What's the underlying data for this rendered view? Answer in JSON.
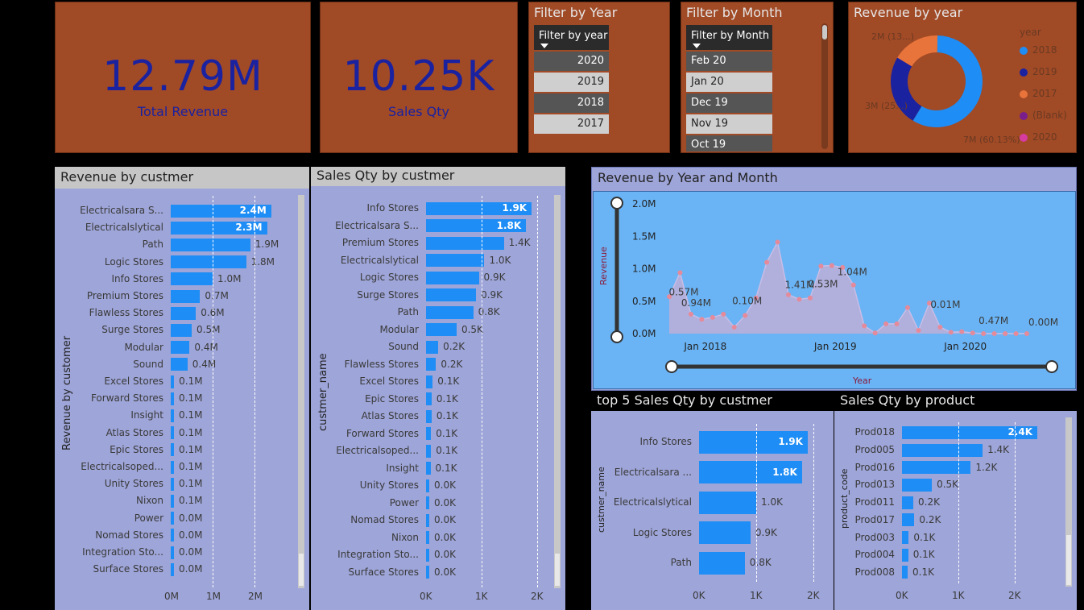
{
  "kpis": {
    "revenue": {
      "value": "12.79M",
      "label": "Total Revenue"
    },
    "qty": {
      "value": "10.25K",
      "label": "Sales Qty"
    }
  },
  "colors": {
    "accent": "#1e8df5",
    "kpi_bg": "#a14a26",
    "kpi_text": "#1b22a0",
    "panel_bg": "#9ea5d8",
    "line_panel_bg": "#6ab4f5"
  },
  "year_slicer": {
    "title": "Filter by Year",
    "header": "Filter by year",
    "items": [
      "2020",
      "2019",
      "2018",
      "2017"
    ]
  },
  "month_slicer": {
    "title": "Filter by Month",
    "header": "Filter by Month",
    "items": [
      "Feb 20",
      "Jan 20",
      "Dec 19",
      "Nov 19",
      "Oct 19"
    ]
  },
  "donut": {
    "title": "Revenue by year",
    "legend_title": "year",
    "legend": [
      {
        "name": "2018",
        "color": "#1e8df5"
      },
      {
        "name": "2019",
        "color": "#1b22a0"
      },
      {
        "name": "2017",
        "color": "#e8743b"
      },
      {
        "name": "(Blank)",
        "color": "#7a1e8c"
      },
      {
        "name": "2020",
        "color": "#d63ba0"
      }
    ],
    "labels": {
      "top": "2M (13...)",
      "left": "3M (25...)",
      "right": "7M (60.13%)"
    }
  },
  "rev_by_cust": {
    "title": "Revenue by custmer",
    "y_title": "Revenue by customer",
    "ticks": [
      "0M",
      "1M",
      "2M"
    ],
    "rows": [
      {
        "name": "Electricalsara S...",
        "value": 2.4,
        "label": "2.4M"
      },
      {
        "name": "Electricalslytical",
        "value": 2.3,
        "label": "2.3M"
      },
      {
        "name": "Path",
        "value": 1.9,
        "label": "1.9M"
      },
      {
        "name": "Logic Stores",
        "value": 1.8,
        "label": "1.8M"
      },
      {
        "name": "Info Stores",
        "value": 1.0,
        "label": "1.0M"
      },
      {
        "name": "Premium Stores",
        "value": 0.7,
        "label": "0.7M"
      },
      {
        "name": "Flawless Stores",
        "value": 0.6,
        "label": "0.6M"
      },
      {
        "name": "Surge Stores",
        "value": 0.5,
        "label": "0.5M"
      },
      {
        "name": "Modular",
        "value": 0.45,
        "label": "0.4M"
      },
      {
        "name": "Sound",
        "value": 0.4,
        "label": "0.4M"
      },
      {
        "name": "Excel Stores",
        "value": 0.08,
        "label": "0.1M"
      },
      {
        "name": "Forward Stores",
        "value": 0.07,
        "label": "0.1M"
      },
      {
        "name": "Insight",
        "value": 0.06,
        "label": "0.1M"
      },
      {
        "name": "Atlas Stores",
        "value": 0.06,
        "label": "0.1M"
      },
      {
        "name": "Epic Stores",
        "value": 0.05,
        "label": "0.1M"
      },
      {
        "name": "Electricalsoped...",
        "value": 0.05,
        "label": "0.1M"
      },
      {
        "name": "Unity Stores",
        "value": 0.05,
        "label": "0.1M"
      },
      {
        "name": "Nixon",
        "value": 0.05,
        "label": "0.1M"
      },
      {
        "name": "Power",
        "value": 0.04,
        "label": "0.0M"
      },
      {
        "name": "Nomad Stores",
        "value": 0.04,
        "label": "0.0M"
      },
      {
        "name": "Integration Sto...",
        "value": 0.03,
        "label": "0.0M"
      },
      {
        "name": "Surface Stores",
        "value": 0.03,
        "label": "0.0M"
      }
    ]
  },
  "qty_by_cust": {
    "title": "Sales Qty by custmer",
    "y_title": "custmer_name",
    "ticks": [
      "0K",
      "1K",
      "2K"
    ],
    "rows": [
      {
        "name": "Info Stores",
        "value": 1.9,
        "label": "1.9K"
      },
      {
        "name": "Electricalsara S...",
        "value": 1.8,
        "label": "1.8K"
      },
      {
        "name": "Premium Stores",
        "value": 1.4,
        "label": "1.4K"
      },
      {
        "name": "Electricalslytical",
        "value": 1.05,
        "label": "1.0K"
      },
      {
        "name": "Logic Stores",
        "value": 0.95,
        "label": "0.9K"
      },
      {
        "name": "Surge Stores",
        "value": 0.9,
        "label": "0.9K"
      },
      {
        "name": "Path",
        "value": 0.85,
        "label": "0.8K"
      },
      {
        "name": "Modular",
        "value": 0.55,
        "label": "0.5K"
      },
      {
        "name": "Sound",
        "value": 0.22,
        "label": "0.2K"
      },
      {
        "name": "Flawless Stores",
        "value": 0.18,
        "label": "0.2K"
      },
      {
        "name": "Excel Stores",
        "value": 0.12,
        "label": "0.1K"
      },
      {
        "name": "Epic Stores",
        "value": 0.1,
        "label": "0.1K"
      },
      {
        "name": "Atlas Stores",
        "value": 0.1,
        "label": "0.1K"
      },
      {
        "name": "Forward Stores",
        "value": 0.09,
        "label": "0.1K"
      },
      {
        "name": "Electricalsoped...",
        "value": 0.09,
        "label": "0.1K"
      },
      {
        "name": "Insight",
        "value": 0.08,
        "label": "0.1K"
      },
      {
        "name": "Unity Stores",
        "value": 0.04,
        "label": "0.0K"
      },
      {
        "name": "Power",
        "value": 0.04,
        "label": "0.0K"
      },
      {
        "name": "Nomad Stores",
        "value": 0.03,
        "label": "0.0K"
      },
      {
        "name": "Nixon",
        "value": 0.03,
        "label": "0.0K"
      },
      {
        "name": "Integration Sto...",
        "value": 0.02,
        "label": "0.0K"
      },
      {
        "name": "Surface Stores",
        "value": 0.02,
        "label": "0.0K"
      }
    ]
  },
  "line": {
    "title": "Revenue by Year and Month",
    "y_title": "Revenue",
    "x_title": "Year",
    "y_ticks": [
      "2.0M",
      "1.5M",
      "1.0M",
      "0.5M",
      "0.0M"
    ],
    "x_ticks": [
      "Jan 2018",
      "Jan 2019",
      "Jan 2020"
    ],
    "annotations": [
      {
        "text": "0.94M",
        "i": 2
      },
      {
        "text": "0.57M",
        "i": 1
      },
      {
        "text": "0.10M",
        "i": 7
      },
      {
        "text": "1.41M",
        "i": 12
      },
      {
        "text": "0.53M",
        "i": 14
      },
      {
        "text": "1.04M",
        "i": 17
      },
      {
        "text": "0.01M",
        "i": 25
      },
      {
        "text": "0.47M",
        "i": 29
      },
      {
        "text": "0.00M",
        "i": 33
      }
    ]
  },
  "chart_data": [
    {
      "type": "area",
      "title": "Revenue by Year and Month",
      "xlabel": "Year",
      "ylabel": "Revenue",
      "ylim": [
        0,
        2.0
      ],
      "x": [
        "Oct 2017",
        "Nov 2017",
        "Dec 2017",
        "Jan 2018",
        "Feb 2018",
        "Mar 2018",
        "Apr 2018",
        "May 2018",
        "Jun 2018",
        "Jul 2018",
        "Aug 2018",
        "Sep 2018",
        "Oct 2018",
        "Nov 2018",
        "Dec 2018",
        "Jan 2019",
        "Feb 2019",
        "Mar 2019",
        "Apr 2019",
        "May 2019",
        "Jun 2019",
        "Jul 2019",
        "Aug 2019",
        "Sep 2019",
        "Oct 2019",
        "Nov 2019",
        "Dec 2019",
        "Jan 2020",
        "Feb 2020",
        "Mar 2020",
        "Apr 2020",
        "May 2020",
        "Jun 2020",
        "Jul 2020"
      ],
      "series": [
        {
          "name": "Revenue",
          "values": [
            0.57,
            0.94,
            0.3,
            0.22,
            0.25,
            0.3,
            0.1,
            0.28,
            0.55,
            1.1,
            1.41,
            0.6,
            0.53,
            0.55,
            1.04,
            1.05,
            1.02,
            0.75,
            0.12,
            0.01,
            0.15,
            0.15,
            0.4,
            0.05,
            0.47,
            0.1,
            0.02,
            0.03,
            0.01,
            0.0,
            0.0,
            0.0,
            0.0,
            0.0
          ]
        }
      ]
    },
    {
      "type": "bar",
      "title": "top 5 Sales Qty by custmer",
      "ylabel": "custmer_name",
      "categories": [
        "Info Stores",
        "Electricalsara ...",
        "Electricalslytical",
        "Logic Stores",
        "Path"
      ],
      "values": [
        1.9,
        1.8,
        1.0,
        0.9,
        0.8
      ]
    },
    {
      "type": "bar",
      "title": "Sales Qty by product",
      "ylabel": "product_code",
      "categories": [
        "Prod018",
        "Prod005",
        "Prod016",
        "Prod013",
        "Prod011",
        "Prod017",
        "Prod003",
        "Prod004",
        "Prod008"
      ],
      "values": [
        2.4,
        1.4,
        1.2,
        0.5,
        0.2,
        0.2,
        0.1,
        0.1,
        0.1
      ]
    },
    {
      "type": "pie",
      "title": "Revenue by year",
      "categories": [
        "2018",
        "2019",
        "2017"
      ],
      "values": [
        7,
        3,
        2
      ]
    }
  ],
  "top5": {
    "title": "top 5 Sales Qty by custmer",
    "y_title": "custmer_name",
    "ticks": [
      "0K",
      "1K",
      "2K"
    ],
    "rows": [
      {
        "name": "Info Stores",
        "value": 1.9,
        "label": "1.9K"
      },
      {
        "name": "Electricalsara ...",
        "value": 1.8,
        "label": "1.8K"
      },
      {
        "name": "Electricalslytical",
        "value": 1.0,
        "label": "1.0K"
      },
      {
        "name": "Logic Stores",
        "value": 0.9,
        "label": "0.9K"
      },
      {
        "name": "Path",
        "value": 0.8,
        "label": "0.8K"
      }
    ]
  },
  "by_product": {
    "title": "Sales Qty by product",
    "y_title": "product_code",
    "ticks": [
      "0K",
      "1K",
      "2K"
    ],
    "rows": [
      {
        "name": "Prod018",
        "value": 2.4,
        "label": "2.4K"
      },
      {
        "name": "Prod005",
        "value": 1.43,
        "label": "1.4K"
      },
      {
        "name": "Prod016",
        "value": 1.22,
        "label": "1.2K"
      },
      {
        "name": "Prod013",
        "value": 0.53,
        "label": "0.5K"
      },
      {
        "name": "Prod011",
        "value": 0.2,
        "label": "0.2K"
      },
      {
        "name": "Prod017",
        "value": 0.22,
        "label": "0.2K"
      },
      {
        "name": "Prod003",
        "value": 0.12,
        "label": "0.1K"
      },
      {
        "name": "Prod004",
        "value": 0.11,
        "label": "0.1K"
      },
      {
        "name": "Prod008",
        "value": 0.1,
        "label": "0.1K"
      }
    ]
  }
}
